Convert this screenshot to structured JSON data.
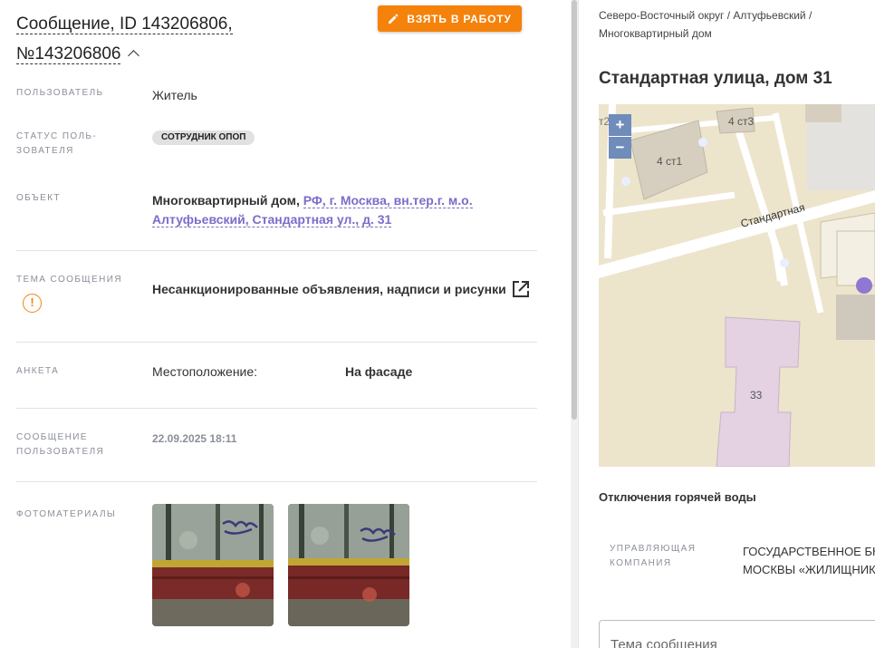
{
  "message": {
    "title_line1": "Сообщение, ID 143206806,",
    "title_line2": "№143206806",
    "take_button": "ВЗЯТЬ В РАБОТУ"
  },
  "fields": {
    "user_label": "ПОЛЬЗОВАТЕЛЬ",
    "user_value": "Житель",
    "status_label_1": "СТАТУС ПОЛЬ-",
    "status_label_2": "ЗОВАТЕЛЯ",
    "status_value": "СОТРУДНИК ОПОП",
    "object_label": "ОБЪЕКТ",
    "object_type": "Многоквартирный дом, ",
    "object_address_1": "РФ, г. Москва, вн.тер.г. м.о.",
    "object_address_2": "Алтуфьевский, Стандартная ул., д. 31",
    "topic_label": "ТЕМА СООБЩЕНИЯ",
    "topic_value": "Несанкционированные объявления, надписи и рисунки",
    "survey_label": "АНКЕТА",
    "survey_key": "Местоположение:",
    "survey_value": "На фасаде",
    "user_msg_label_1": "СООБЩЕНИЕ",
    "user_msg_label_2": "ПОЛЬЗОВАТЕЛЯ",
    "user_msg_date": "22.09.2025 18:11",
    "photos_label": "ФОТОМАТЕРИАЛЫ"
  },
  "right": {
    "breadcrumb_1": "Северо-Восточный округ / Алтуфьевский /",
    "breadcrumb_2": "Многоквартирный дом",
    "address": "Стандартная улица, дом 31",
    "map": {
      "zoom_in": "+",
      "zoom_out": "−",
      "street": "Стандартная",
      "bld_4st1": "4 ст1",
      "bld_4st3": "4 ст3",
      "bld_33": "33",
      "bld_t2": "т2"
    },
    "hot_water": "Отключения горячей воды",
    "mc_label_1": "УПРАВЛЯЮЩАЯ",
    "mc_label_2": "КОМПАНИЯ",
    "mc_value_1": "ГОСУДАРСТВЕННОЕ БЮ",
    "mc_value_2": "МОСКВЫ «ЖИЛИЩНИК",
    "topic_placeholder": "Тема сообщения"
  },
  "colors": {
    "accent": "#f5820b",
    "link": "#7c6cc9",
    "map_bg": "#ede4cc",
    "map_zoom": "#6f8cba"
  }
}
